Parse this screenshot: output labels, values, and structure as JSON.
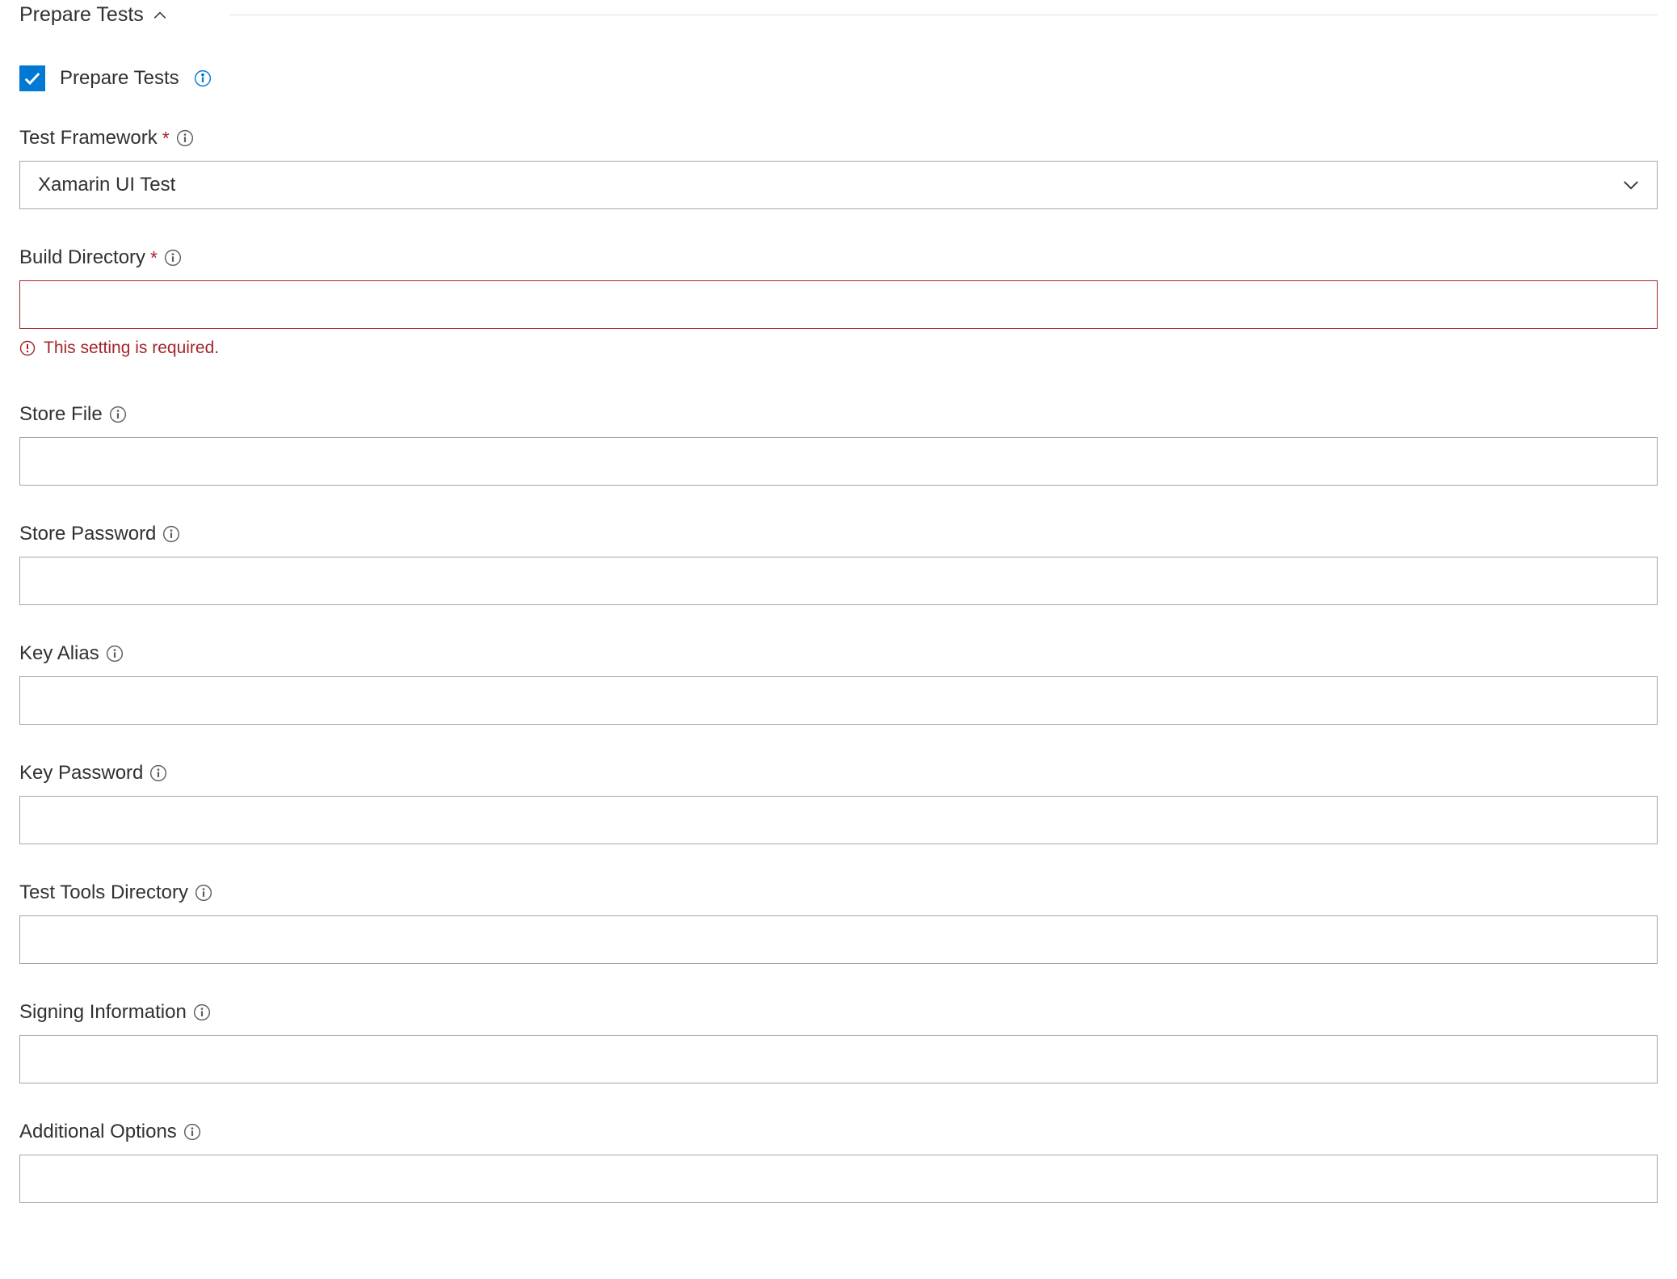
{
  "section": {
    "title": "Prepare Tests"
  },
  "fields": {
    "prepare_tests_checkbox": {
      "label": "Prepare Tests",
      "checked": true
    },
    "test_framework": {
      "label": "Test Framework",
      "required_marker": "*",
      "value": "Xamarin UI Test"
    },
    "build_directory": {
      "label": "Build Directory",
      "required_marker": "*",
      "value": "",
      "error": "This setting is required."
    },
    "store_file": {
      "label": "Store File",
      "value": ""
    },
    "store_password": {
      "label": "Store Password",
      "value": ""
    },
    "key_alias": {
      "label": "Key Alias",
      "value": ""
    },
    "key_password": {
      "label": "Key Password",
      "value": ""
    },
    "test_tools_directory": {
      "label": "Test Tools Directory",
      "value": ""
    },
    "signing_information": {
      "label": "Signing Information",
      "value": ""
    },
    "additional_options": {
      "label": "Additional Options",
      "value": ""
    }
  }
}
